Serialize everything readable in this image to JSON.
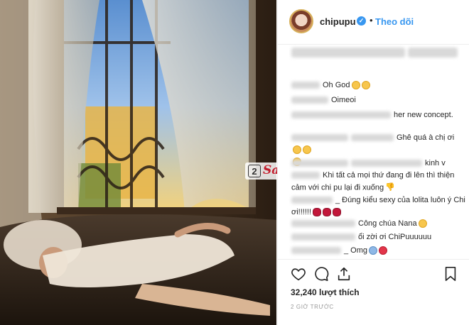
{
  "header": {
    "username": "chipupu",
    "verified_mark": "✓",
    "separator": "•",
    "follow_label": "Theo dõi"
  },
  "comments": [
    {
      "text": "Oh God",
      "emojis": [
        "face-icon",
        "heart-eyes-icon"
      ]
    },
    {
      "text": "Oimeoi",
      "emojis": []
    },
    {
      "text": "her new concept.",
      "emojis": []
    },
    {
      "text": "Ghê quá à chị ơi",
      "emojis": [
        "grin-icon",
        "grin-icon"
      ]
    },
    {
      "text": "kinh v",
      "emojis": []
    },
    {
      "text": "Khi tất cả mọi thứ đang đi lên thì thiện cảm với chi pu lại đi xuống",
      "emojis": [
        "thumbs-down-icon"
      ]
    },
    {
      "text": "_ Đúng kiểu sexy của lolita luôn ý Chi ơi!!!!!!",
      "emojis": [
        "lips-icon",
        "lips-icon",
        "lips-icon"
      ]
    },
    {
      "text": "Công chúa Nana",
      "emojis": [
        "smile-icon"
      ]
    },
    {
      "text": "ổi zời ơi ChiPuuuuuu",
      "emojis": []
    },
    {
      "text": "_ Omg",
      "emojis": [
        "scared-icon",
        "heart-icon"
      ]
    }
  ],
  "watermark": {
    "badge": "2",
    "text": "Sao"
  },
  "likes": "32,240 lượt thích",
  "timestamp": "2 GIỜ TRƯỚC",
  "icons": [
    "heart-outline-icon",
    "comment-icon",
    "share-icon",
    "bookmark-icon"
  ]
}
